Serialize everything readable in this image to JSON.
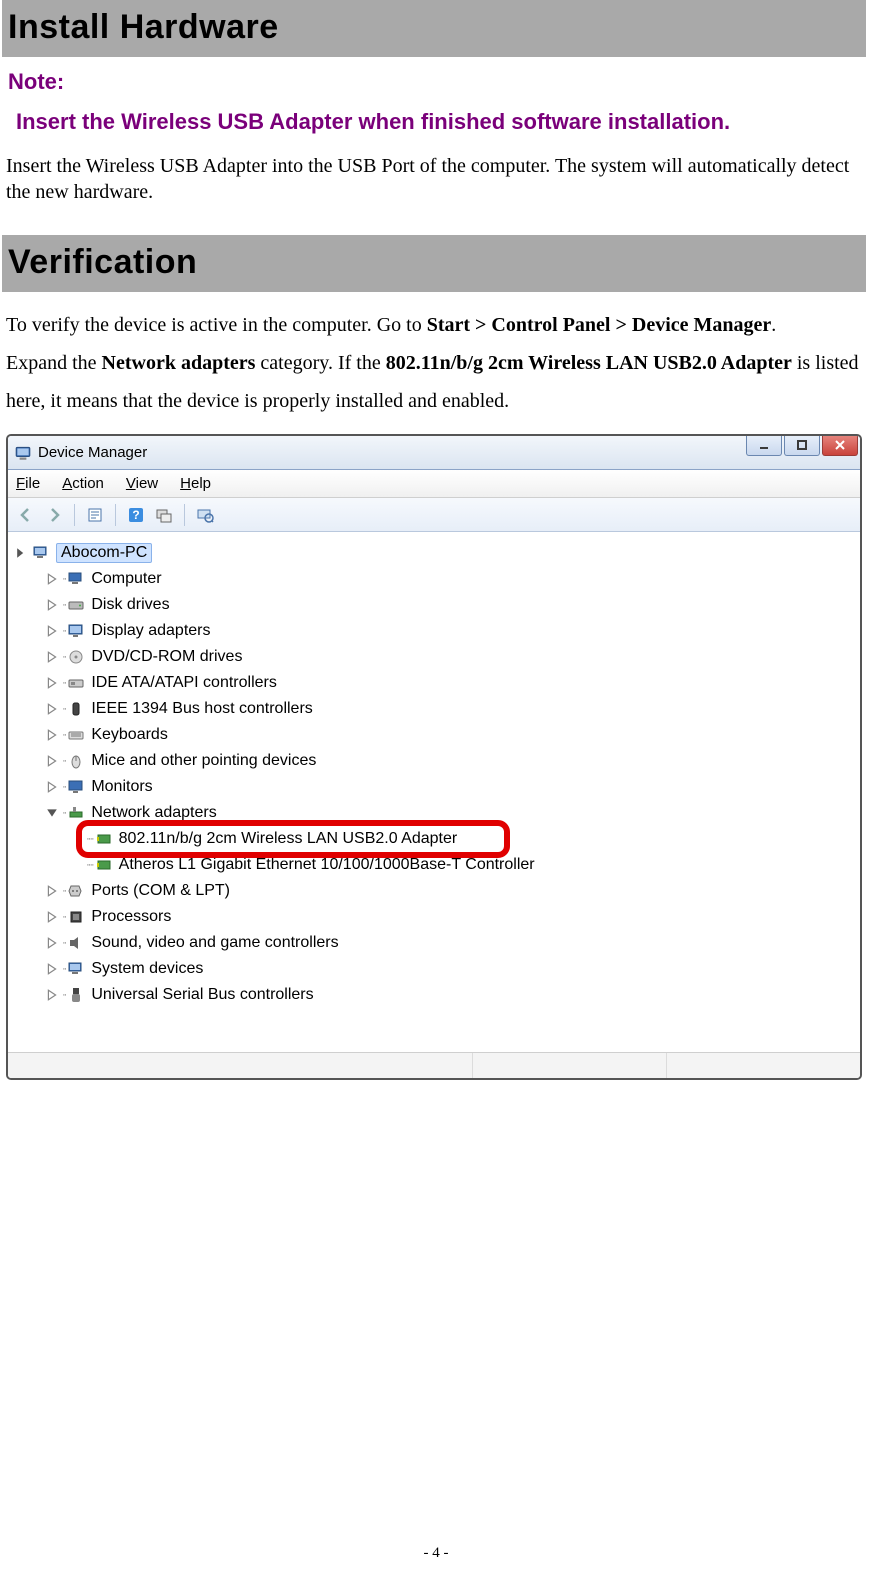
{
  "section1_title": "Install Hardware",
  "note_label": "Note:",
  "note_text": "Insert the Wireless USB Adapter when finished software installation.",
  "insert_text": "Insert the Wireless USB Adapter into the USB Port of the computer. The system will automatically detect the new hardware.",
  "section2_title": "Verification",
  "verify": {
    "p1a": "To verify the device is active in the computer. Go to ",
    "p1b": "Start > Control Panel > Device Manager",
    "p1c": ".",
    "p2a": "Expand the ",
    "p2b": "Network adapters",
    "p2c": " category. If the ",
    "p2d": "802.11n/b/g 2cm Wireless LAN USB2.0 Adapter",
    "p2e": " is listed here, it means that the device is properly installed and enabled."
  },
  "dm": {
    "title": "Device Manager",
    "menu": {
      "file": "File",
      "action": "Action",
      "view": "View",
      "help": "Help"
    },
    "root": "Abocom-PC",
    "nodes": [
      "Computer",
      "Disk drives",
      "Display adapters",
      "DVD/CD-ROM drives",
      "IDE ATA/ATAPI controllers",
      "IEEE 1394 Bus host controllers",
      "Keyboards",
      "Mice and other pointing devices",
      "Monitors"
    ],
    "net_label": "Network adapters",
    "net_children": [
      "802.11n/b/g 2cm Wireless LAN USB2.0 Adapter",
      "Atheros L1 Gigabit Ethernet 10/100/1000Base-T Controller"
    ],
    "nodes_after": [
      "Ports (COM & LPT)",
      "Processors",
      "Sound, video and game controllers",
      "System devices",
      "Universal Serial Bus controllers"
    ]
  },
  "page_number": "- 4 -"
}
